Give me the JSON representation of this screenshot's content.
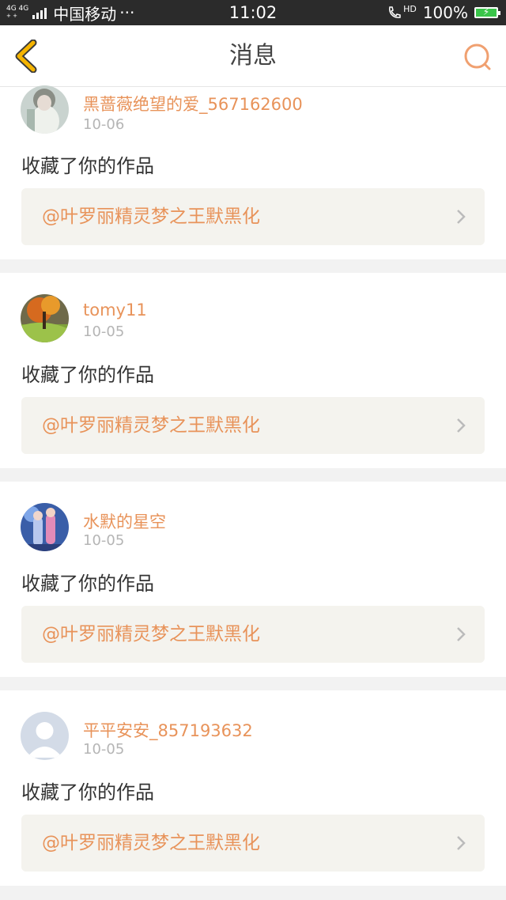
{
  "status_bar": {
    "network_top": "4G 4G",
    "network_bottom": "+ +",
    "carrier": "中国移动",
    "dots": "···",
    "time": "11:02",
    "hd": "HD",
    "battery": "100%"
  },
  "nav": {
    "title": "消息",
    "accent_color": "#f5b400",
    "search_color": "#f0a070"
  },
  "messages": [
    {
      "username": "黑蔷薇绝望的爱_567162600",
      "date": "10-06",
      "action": "收藏了你的作品",
      "work": "@叶罗丽精灵梦之王默黑化",
      "avatar": "avatar-girl-white"
    },
    {
      "username": "tomy11",
      "date": "10-05",
      "action": "收藏了你的作品",
      "work": "@叶罗丽精灵梦之王默黑化",
      "avatar": "avatar-autumn-tree"
    },
    {
      "username": "水默的星空",
      "date": "10-05",
      "action": "收藏了你的作品",
      "work": "@叶罗丽精灵梦之王默黑化",
      "avatar": "avatar-anime-blue"
    },
    {
      "username": "平平安安_857193632",
      "date": "10-05",
      "action": "收藏了你的作品",
      "work": "@叶罗丽精灵梦之王默黑化",
      "avatar": "avatar-default-person"
    }
  ]
}
